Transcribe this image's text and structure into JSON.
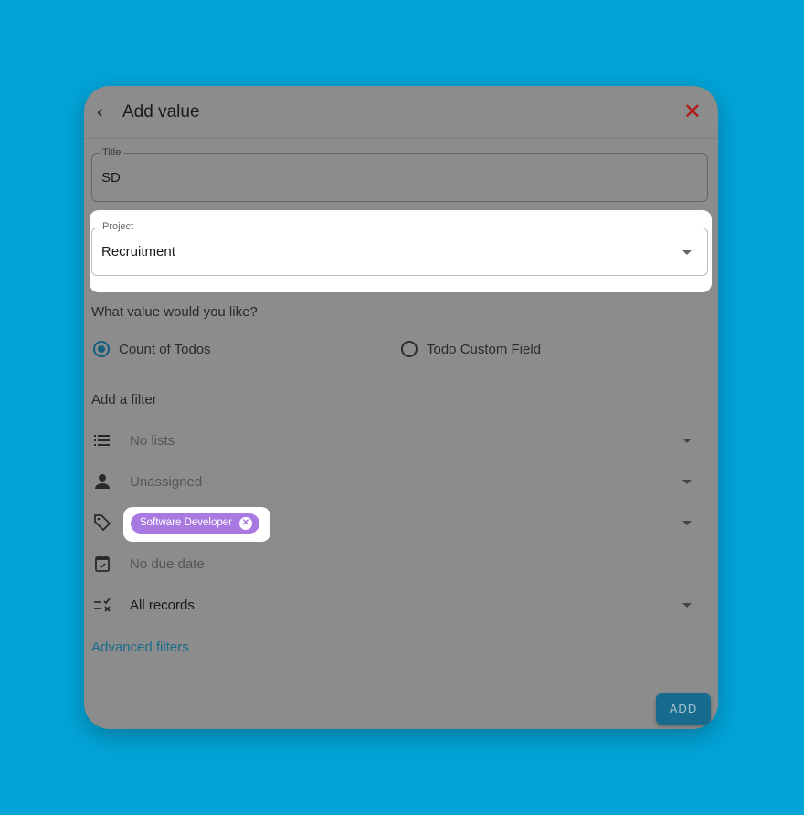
{
  "dialog": {
    "title": "Add value",
    "title_field": {
      "label": "Title",
      "value": "SD"
    },
    "project_field": {
      "label": "Project",
      "value": "Recruitment"
    },
    "value_question": "What value would you like?",
    "value_options": [
      {
        "label": "Count of Todos",
        "selected": true
      },
      {
        "label": "Todo Custom Field",
        "selected": false
      }
    ],
    "filter_heading": "Add a filter",
    "filters": {
      "lists": "No lists",
      "assignee": "Unassigned",
      "tag_chip": "Software Developer",
      "due_date": "No due date",
      "records": "All records"
    },
    "advanced_filters": "Advanced filters",
    "add_button": "ADD"
  },
  "colors": {
    "background": "#02a3d6",
    "chip": "#a879e0",
    "accent": "#166b8e",
    "close": "#b01818"
  }
}
